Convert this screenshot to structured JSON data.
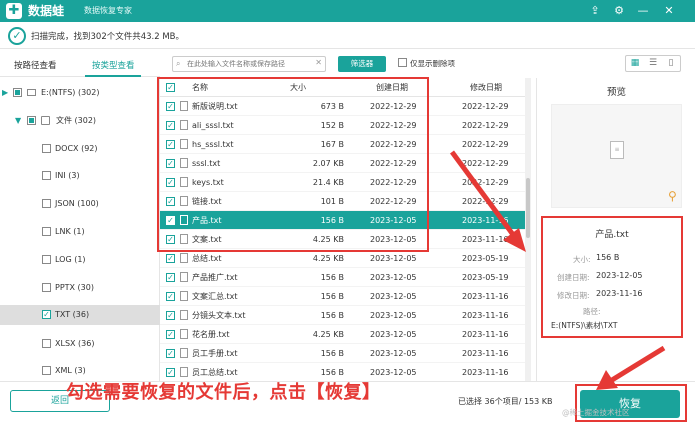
{
  "titlebar": {
    "app_name": "数据蛙",
    "subtitle": "数据恢复专家",
    "logo_glyph": "✚",
    "upload_glyph": "⇪",
    "settings_glyph": "⚙",
    "min_glyph": "—",
    "close_glyph": "✕"
  },
  "status": {
    "check_glyph": "✓",
    "scan_result": "扫描完成，找到302个文件共43.2 MB。"
  },
  "tabs": {
    "by_path": "按路径查看",
    "by_type": "按类型查看"
  },
  "toolbar": {
    "search_placeholder": "在此处输入文件名称或保存路径",
    "search_icon": "⌕",
    "clear_icon": "✕",
    "filter_label": "筛选器",
    "deleted_only_label": "仅显示删除项",
    "layout_icons": [
      "▦",
      "☰",
      "▯"
    ]
  },
  "tree": {
    "drive": "E:(NTFS) (302)",
    "folder": "文件 (302)",
    "types": [
      {
        "label": "DOCX (92)",
        "checked": false
      },
      {
        "label": "INI (3)",
        "checked": false
      },
      {
        "label": "JSON (100)",
        "checked": false
      },
      {
        "label": "LNK (1)",
        "checked": false
      },
      {
        "label": "LOG (1)",
        "checked": false
      },
      {
        "label": "PPTX (30)",
        "checked": false
      },
      {
        "label": "TXT (36)",
        "checked": true
      },
      {
        "label": "XLSX (36)",
        "checked": false
      },
      {
        "label": "XML (3)",
        "checked": false
      }
    ]
  },
  "list": {
    "columns": {
      "name": "名称",
      "size": "大小",
      "created": "创建日期",
      "modified": "修改日期"
    },
    "rows": [
      {
        "name": "新版说明.txt",
        "size": "673  B",
        "created": "2022-12-29",
        "modified": "2022-12-29",
        "selected": false
      },
      {
        "name": "ali_sssl.txt",
        "size": "152  B",
        "created": "2022-12-29",
        "modified": "2022-12-29",
        "selected": false
      },
      {
        "name": "hs_sssl.txt",
        "size": "167  B",
        "created": "2022-12-29",
        "modified": "2022-12-29",
        "selected": false
      },
      {
        "name": "sssl.txt",
        "size": "2.07 KB",
        "created": "2022-12-29",
        "modified": "2022-12-29",
        "selected": false
      },
      {
        "name": "keys.txt",
        "size": "21.4 KB",
        "created": "2022-12-29",
        "modified": "2022-12-29",
        "selected": false
      },
      {
        "name": "链接.txt",
        "size": "101  B",
        "created": "2022-12-29",
        "modified": "2022-12-29",
        "selected": false
      },
      {
        "name": "产品.txt",
        "size": "156  B",
        "created": "2023-12-05",
        "modified": "2023-11-16",
        "selected": true
      },
      {
        "name": "文案.txt",
        "size": "4.25 KB",
        "created": "2023-12-05",
        "modified": "2023-11-16",
        "selected": false
      },
      {
        "name": "总结.txt",
        "size": "4.25 KB",
        "created": "2023-12-05",
        "modified": "2023-05-19",
        "selected": false
      },
      {
        "name": "产品推广.txt",
        "size": "156  B",
        "created": "2023-12-05",
        "modified": "2023-05-19",
        "selected": false
      },
      {
        "name": "文案汇总.txt",
        "size": "156  B",
        "created": "2023-12-05",
        "modified": "2023-11-16",
        "selected": false
      },
      {
        "name": "分镜头文本.txt",
        "size": "156  B",
        "created": "2023-12-05",
        "modified": "2023-11-16",
        "selected": false
      },
      {
        "name": "花名册.txt",
        "size": "4.25 KB",
        "created": "2023-12-05",
        "modified": "2023-11-16",
        "selected": false
      },
      {
        "name": "员工手册.txt",
        "size": "156  B",
        "created": "2023-12-05",
        "modified": "2023-11-16",
        "selected": false
      },
      {
        "name": "员工总结.txt",
        "size": "156  B",
        "created": "2023-12-05",
        "modified": "2023-11-16",
        "selected": false
      }
    ]
  },
  "preview": {
    "title": "预览",
    "doc_glyph": "≡",
    "zoom_glyph": "⚲",
    "file_name": "产品.txt",
    "size_label": "大小:",
    "size_value": "156  B",
    "created_label": "创建日期:",
    "created_value": "2023-12-05",
    "modified_label": "修改日期:",
    "modified_value": "2023-11-16",
    "path_label": "路径:",
    "path_value": "E:(NTFS)\\素材\\TXT"
  },
  "footer": {
    "back_label": "返回",
    "selected_info": "已选择 36个项目/ 153 KB",
    "recover_label": "恢复",
    "instruction": "勾选需要恢复的文件后，点击【恢复】",
    "watermark": "@稀土掘金技术社区"
  },
  "colors": {
    "accent": "#1aa39b",
    "highlight_red": "#e53935"
  }
}
